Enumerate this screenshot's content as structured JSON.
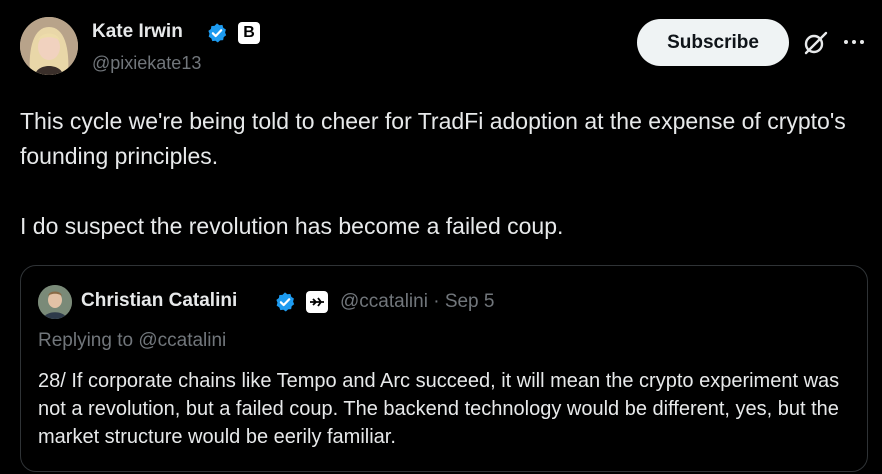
{
  "author": {
    "name": "Kate Irwin",
    "handle": "@pixiekate13",
    "affiliate_letter": "B"
  },
  "actions": {
    "subscribe_label": "Subscribe",
    "grok_icon": "grok-slash-icon",
    "more_icon": "more-horizontal-icon"
  },
  "tweet": {
    "paragraphs": [
      "This cycle we're being told to cheer for TradFi adoption at the expense of crypto's founding principles.",
      "I do suspect the revolution has become a failed coup."
    ]
  },
  "quote": {
    "name": "Christian Catalini",
    "meta": "@ccatalini · Sep 5",
    "replying": "Replying to @ccatalini",
    "text": "28/ If corporate chains like Tempo and Arc succeed, it will mean the crypto experiment was not a revolution, but a failed coup. The backend technology would be different, yes, but the market structure would be eerily familiar."
  },
  "colors": {
    "background": "#000000",
    "text": "#e7e9ea",
    "muted": "#71767b",
    "verified": "#1d9bf0",
    "border": "#2f3336"
  }
}
